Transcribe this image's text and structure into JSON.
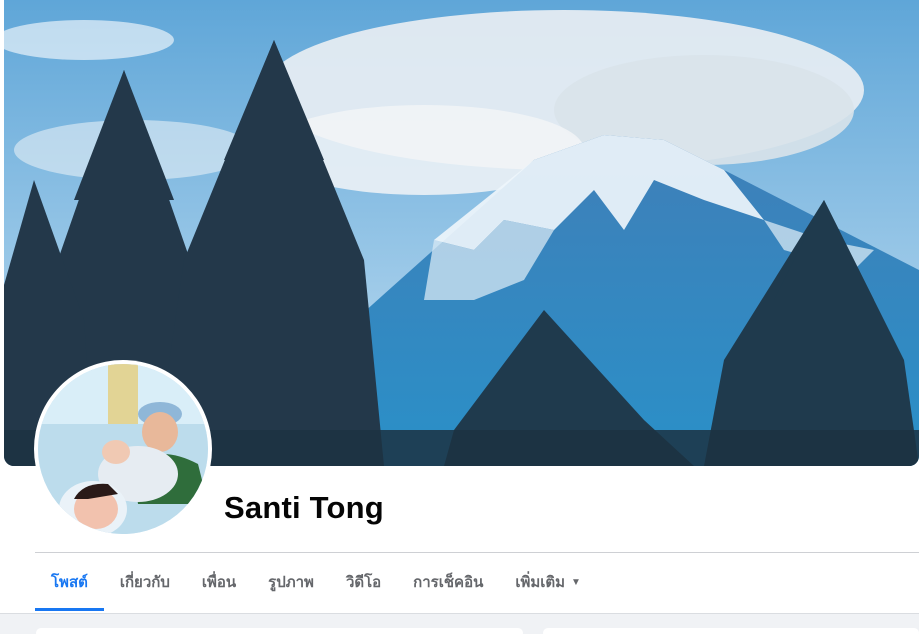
{
  "profile": {
    "name": "Santi Tong"
  },
  "cover": {
    "icon": "mountain-landscape-photo"
  },
  "avatar": {
    "icon": "family-newborn-photo"
  },
  "tabs": [
    {
      "label": "โพสต์",
      "active": true
    },
    {
      "label": "เกี่ยวกับ",
      "active": false
    },
    {
      "label": "เพื่อน",
      "active": false
    },
    {
      "label": "รูปภาพ",
      "active": false
    },
    {
      "label": "วิดีโอ",
      "active": false
    },
    {
      "label": "การเช็คอิน",
      "active": false
    },
    {
      "label": "เพิ่มเติม",
      "active": false
    }
  ],
  "colors": {
    "accent": "#1877f2",
    "tab_text": "#65676b",
    "name_text": "#050505",
    "page_bg": "#f0f2f5"
  }
}
